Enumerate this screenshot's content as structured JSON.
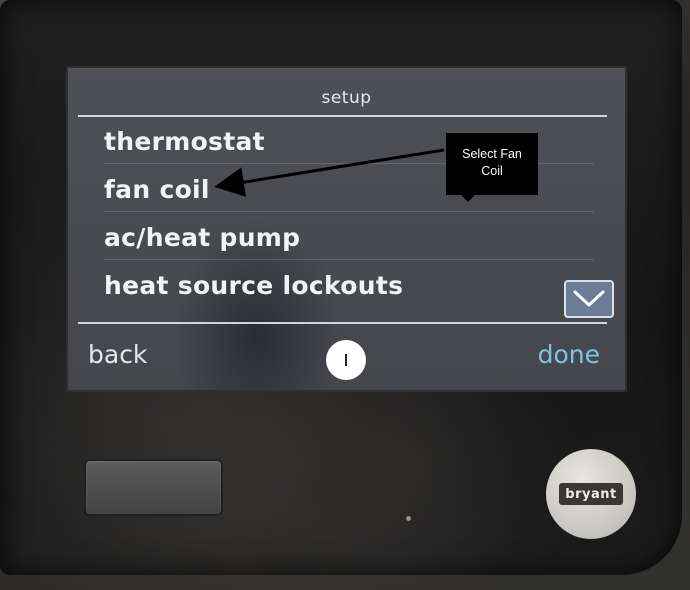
{
  "screen": {
    "title": "setup",
    "menu_items": [
      "thermostat",
      "fan coil",
      "ac/heat pump",
      "heat source lockouts"
    ],
    "back_label": "back",
    "done_label": "done",
    "page_indicator": "I",
    "scroll_icon": "chevron-down-icon"
  },
  "annotation": {
    "callout_text_line1": "Select Fan",
    "callout_text_line2": "Coil"
  },
  "device": {
    "brand": "bryant"
  },
  "colors": {
    "screen_bg": "#4b4d53",
    "text": "#f2f3f5",
    "done_accent": "#7cc2ea",
    "rule": "#c9d6e6"
  }
}
